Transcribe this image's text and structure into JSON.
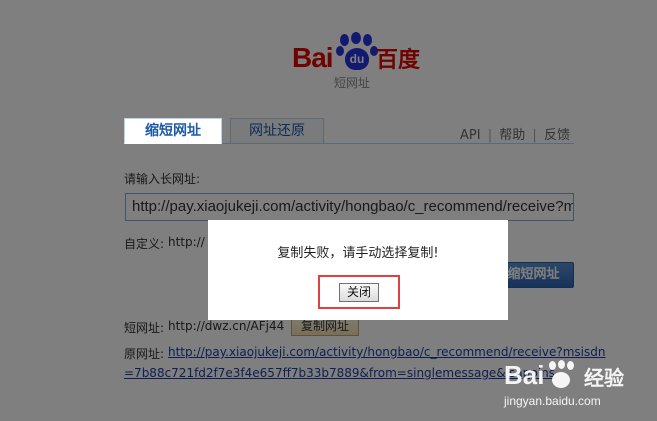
{
  "logo": {
    "brand_left": "Bai",
    "paw_text": "du",
    "brand_right": "百度",
    "subtitle": "短网址"
  },
  "tabs": [
    {
      "label": "缩短网址",
      "active": true
    },
    {
      "label": "网址还原",
      "active": false
    }
  ],
  "top_links": {
    "api": "API",
    "help": "帮助",
    "feedback": "反馈",
    "sep": "|"
  },
  "form": {
    "long_url_label": "请输入长网址:",
    "long_url_value": "http://pay.xiaojukeji.com/activity/hongbao/c_recommend/receive?ms",
    "custom_label": "自定义:",
    "custom_value": "http://",
    "shorten_button": "缩短网址"
  },
  "result": {
    "short_label": "短网址:",
    "short_value": "http://dwz.cn/AFj44",
    "copy_button": "复制网址",
    "original_label": "原网址:",
    "original_link_line1": "http://pay.xiaojukeji.com/activity/hongbao/c_recommend/receive?msisdn",
    "original_link_line2": "=7b88c721fd2f7e3f4e657ff7b33b7889&from=singlemessage&isappinstalled"
  },
  "modal": {
    "message": "复制失败，请手动选择复制!",
    "close_button": "关闭"
  },
  "watermark": {
    "brand_left": "Bai",
    "brand_right": "经验",
    "url": "jingyan.baidu.com"
  },
  "colors": {
    "brand_red": "#e10601",
    "brand_blue": "#2932e1",
    "link_blue": "#1e3fa3",
    "highlight_red": "#e04040",
    "overlay": "rgba(0,0,0,0.5)"
  }
}
